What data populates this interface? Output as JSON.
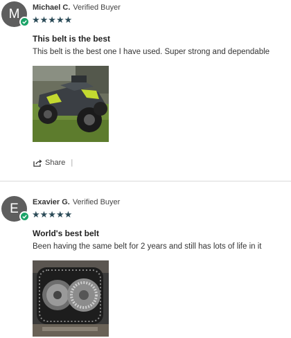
{
  "reviews": [
    {
      "avatar_letter": "M",
      "name": "Michael C.",
      "badge": "Verified Buyer",
      "stars": "★★★★★",
      "rating": 5,
      "title": "This belt is the best",
      "body": "This belt is the best one I have used. Super strong and dependable",
      "share_label": "Share",
      "share_separator": "|"
    },
    {
      "avatar_letter": "E",
      "name": "Exavier G.",
      "badge": "Verified Buyer",
      "stars": "★★★★★",
      "rating": 5,
      "title": "World's best belt",
      "body": "Been having the same belt for 2 years and still has lots of life in it"
    }
  ],
  "colors": {
    "avatar": "#5e5e5e",
    "verified": "#1aa367",
    "stars": "#2a4a57"
  }
}
